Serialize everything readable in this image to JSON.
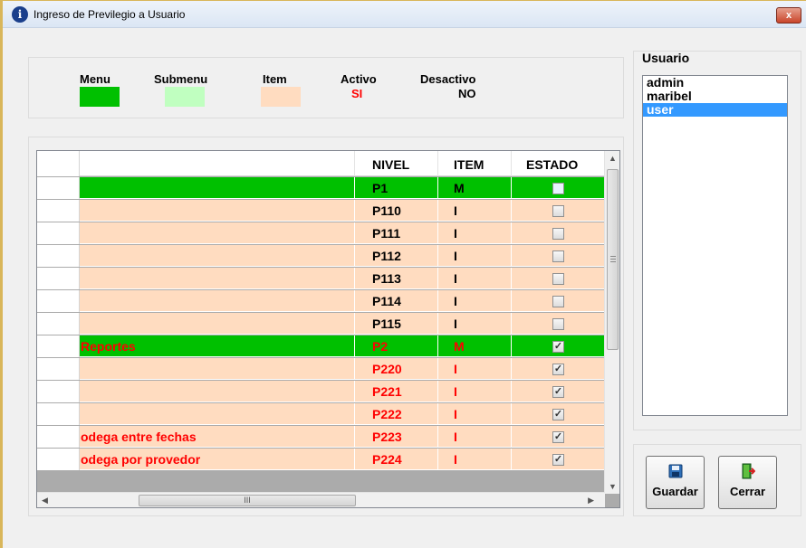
{
  "window": {
    "title": "Ingreso de Previlegio a Usuario",
    "close_label": "x"
  },
  "legend": {
    "menu_label": "Menu",
    "submenu_label": "Submenu",
    "item_label": "Item",
    "activo_label": "Activo",
    "activo_value": "SI",
    "desactivo_label": "Desactivo",
    "desactivo_value": "NO",
    "colors": {
      "menu": "#00c000",
      "submenu": "#c0ffc0",
      "item": "#ffdcc0",
      "active_text": "#ff0000"
    }
  },
  "grid": {
    "columns": [
      "",
      "NIVEL",
      "ITEM",
      "ESTADO"
    ],
    "rows": [
      {
        "desc": "",
        "nivel": "P1",
        "item": "M",
        "checked": false,
        "type": "menu",
        "active": false
      },
      {
        "desc": "",
        "nivel": "P110",
        "item": "I",
        "checked": false,
        "type": "item",
        "active": false
      },
      {
        "desc": "",
        "nivel": "P111",
        "item": "I",
        "checked": false,
        "type": "item",
        "active": false
      },
      {
        "desc": "",
        "nivel": "P112",
        "item": "I",
        "checked": false,
        "type": "item",
        "active": false
      },
      {
        "desc": "",
        "nivel": "P113",
        "item": "I",
        "checked": false,
        "type": "item",
        "active": false
      },
      {
        "desc": "",
        "nivel": "P114",
        "item": "I",
        "checked": false,
        "type": "item",
        "active": false
      },
      {
        "desc": "",
        "nivel": "P115",
        "item": "I",
        "checked": false,
        "type": "item",
        "active": false
      },
      {
        "desc": "Reportes",
        "nivel": "P2",
        "item": "M",
        "checked": true,
        "type": "menu",
        "active": true
      },
      {
        "desc": "",
        "nivel": "P220",
        "item": "I",
        "checked": true,
        "type": "item",
        "active": true
      },
      {
        "desc": "",
        "nivel": "P221",
        "item": "I",
        "checked": true,
        "type": "item",
        "active": true
      },
      {
        "desc": "",
        "nivel": "P222",
        "item": "I",
        "checked": true,
        "type": "item",
        "active": true
      },
      {
        "desc": "odega entre fechas",
        "nivel": "P223",
        "item": "I",
        "checked": true,
        "type": "item",
        "active": true
      },
      {
        "desc": "odega por provedor",
        "nivel": "P224",
        "item": "I",
        "checked": true,
        "type": "item",
        "active": true
      }
    ],
    "hscroll_grip": "III"
  },
  "users": {
    "title": "Usuario",
    "items": [
      "admin",
      "maribel",
      "user"
    ],
    "selected": 2
  },
  "buttons": {
    "save_label": "Guardar",
    "close_label": "Cerrar"
  }
}
